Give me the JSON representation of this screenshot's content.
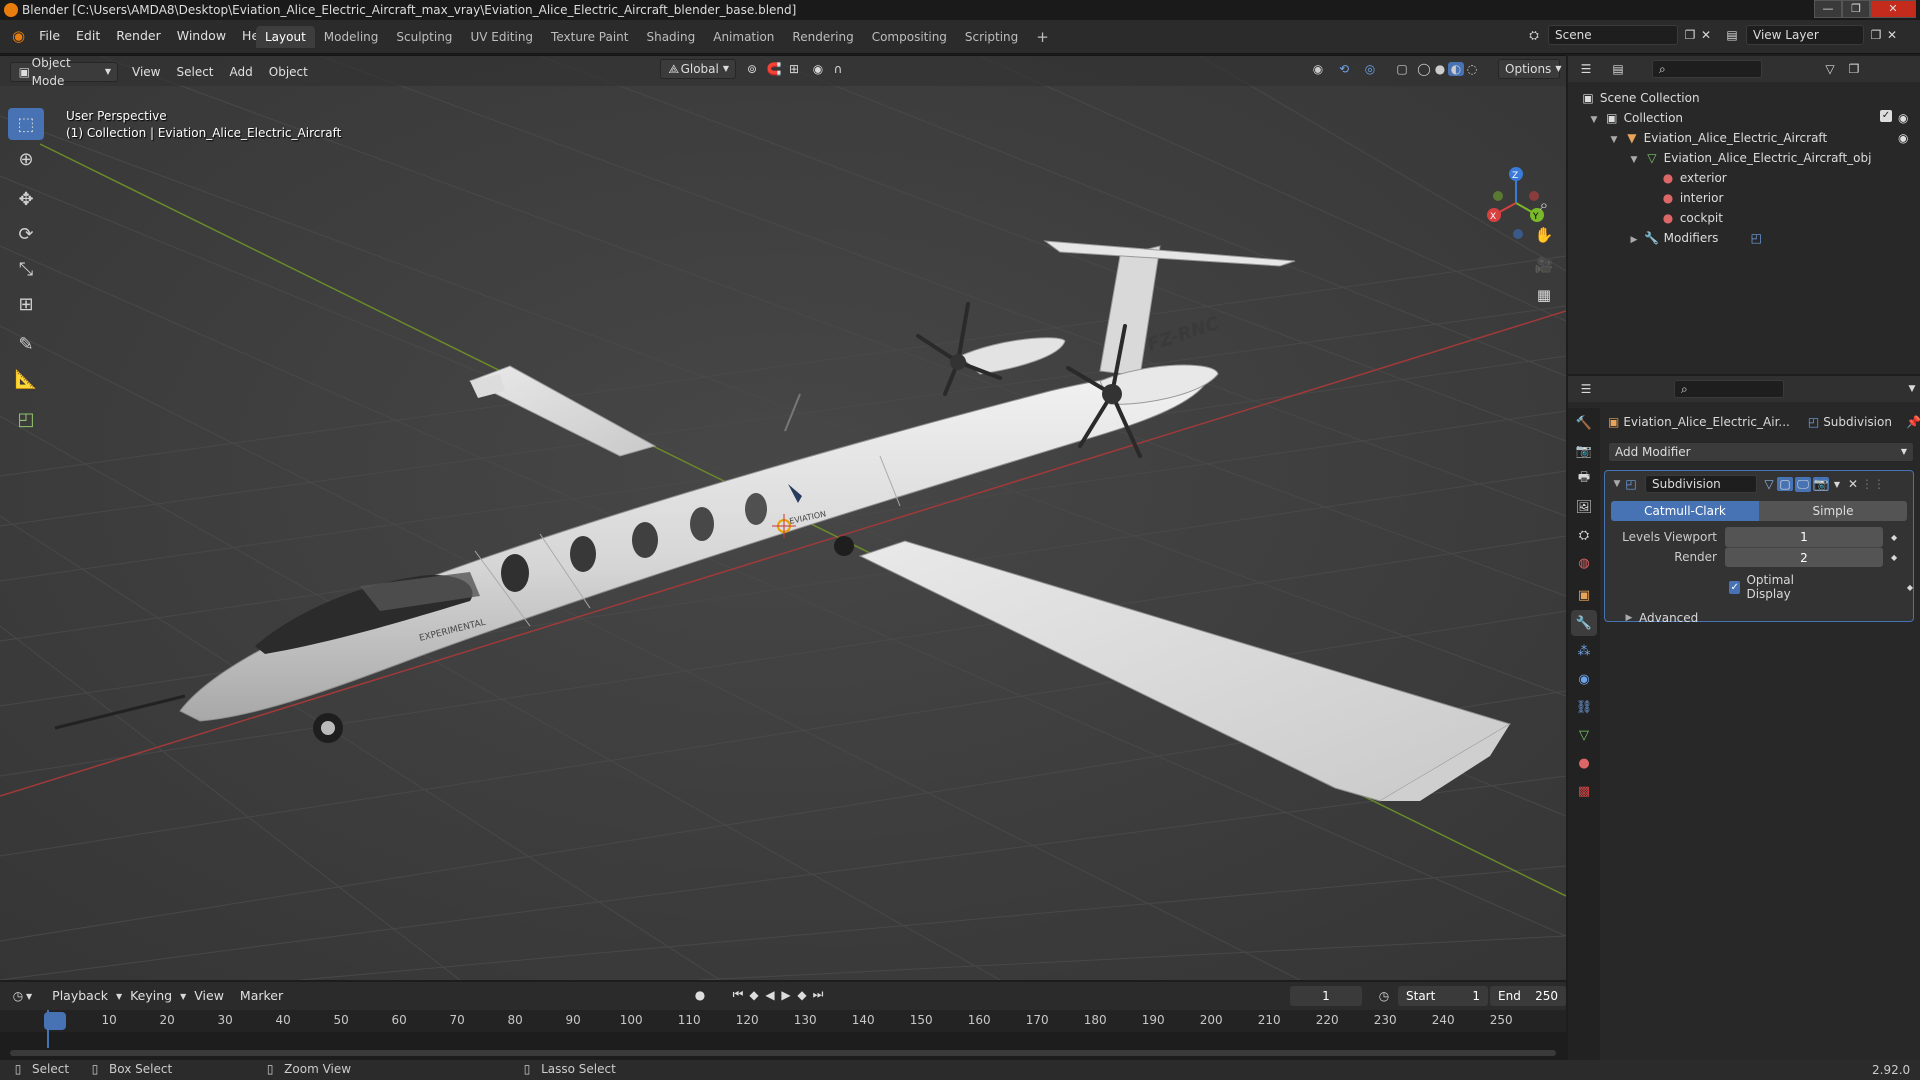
{
  "window": {
    "title": "Blender [C:\\Users\\AMDA8\\Desktop\\Eviation_Alice_Electric_Aircraft_max_vray\\Eviation_Alice_Electric_Aircraft_blender_base.blend]",
    "min": "—",
    "max": "❐",
    "close": "✕"
  },
  "menubar": {
    "items": [
      "File",
      "Edit",
      "Render",
      "Window",
      "Help"
    ],
    "workspaces": [
      "Layout",
      "Modeling",
      "Sculpting",
      "UV Editing",
      "Texture Paint",
      "Shading",
      "Animation",
      "Rendering",
      "Compositing",
      "Scripting"
    ],
    "add_tab": "+",
    "scene": "Scene",
    "view_layer": "View Layer"
  },
  "tool_header": {
    "orientation": "Global",
    "options": "Options"
  },
  "viewport": {
    "mode": "Object Mode",
    "menus": [
      "View",
      "Select",
      "Add",
      "Object"
    ],
    "perspective": "User Perspective",
    "collection_info": "(1) Collection | Eviation_Alice_Electric_Aircraft",
    "axis_x": "X",
    "axis_y": "Y",
    "axis_z": "Z",
    "aircraft_reg": "FZ-RNC",
    "aircraft_brand": "EVIATION",
    "aircraft_label": "EXPERIMENTAL"
  },
  "outliner": {
    "scene_collection": "Scene Collection",
    "collection": "Collection",
    "object": "Eviation_Alice_Electric_Aircraft",
    "mesh": "Eviation_Alice_Electric_Aircraft_obj",
    "materials": [
      "exterior",
      "interior",
      "cockpit"
    ],
    "modifiers": "Modifiers"
  },
  "properties": {
    "object_name": "Eviation_Alice_Electric_Air...",
    "modifier_context": "Subdivision",
    "add_modifier": "Add Modifier",
    "modifier_name": "Subdivision",
    "catmull": "Catmull-Clark",
    "simple": "Simple",
    "levels_viewport_label": "Levels Viewport",
    "levels_viewport_value": "1",
    "render_label": "Render",
    "render_value": "2",
    "optimal_display": "Optimal Display",
    "advanced": "Advanced"
  },
  "timeline": {
    "menus": [
      "Playback",
      "Keying",
      "View",
      "Marker"
    ],
    "current_frame": "1",
    "start_label": "Start",
    "start_value": "1",
    "end_label": "End",
    "end_value": "250",
    "ticks": [
      "1",
      "10",
      "20",
      "30",
      "40",
      "50",
      "60",
      "70",
      "80",
      "90",
      "100",
      "110",
      "120",
      "130",
      "140",
      "150",
      "160",
      "170",
      "180",
      "190",
      "200",
      "210",
      "220",
      "230",
      "240",
      "250"
    ]
  },
  "statusbar": {
    "select": "Select",
    "box_select": "Box Select",
    "zoom_view": "Zoom View",
    "lasso_select": "Lasso Select",
    "version": "2.92.0"
  },
  "colors": {
    "accent": "#4772b3",
    "x_axis": "#a03a3a",
    "y_axis": "#6a8a2a",
    "blender_orange": "#e87d0d"
  }
}
